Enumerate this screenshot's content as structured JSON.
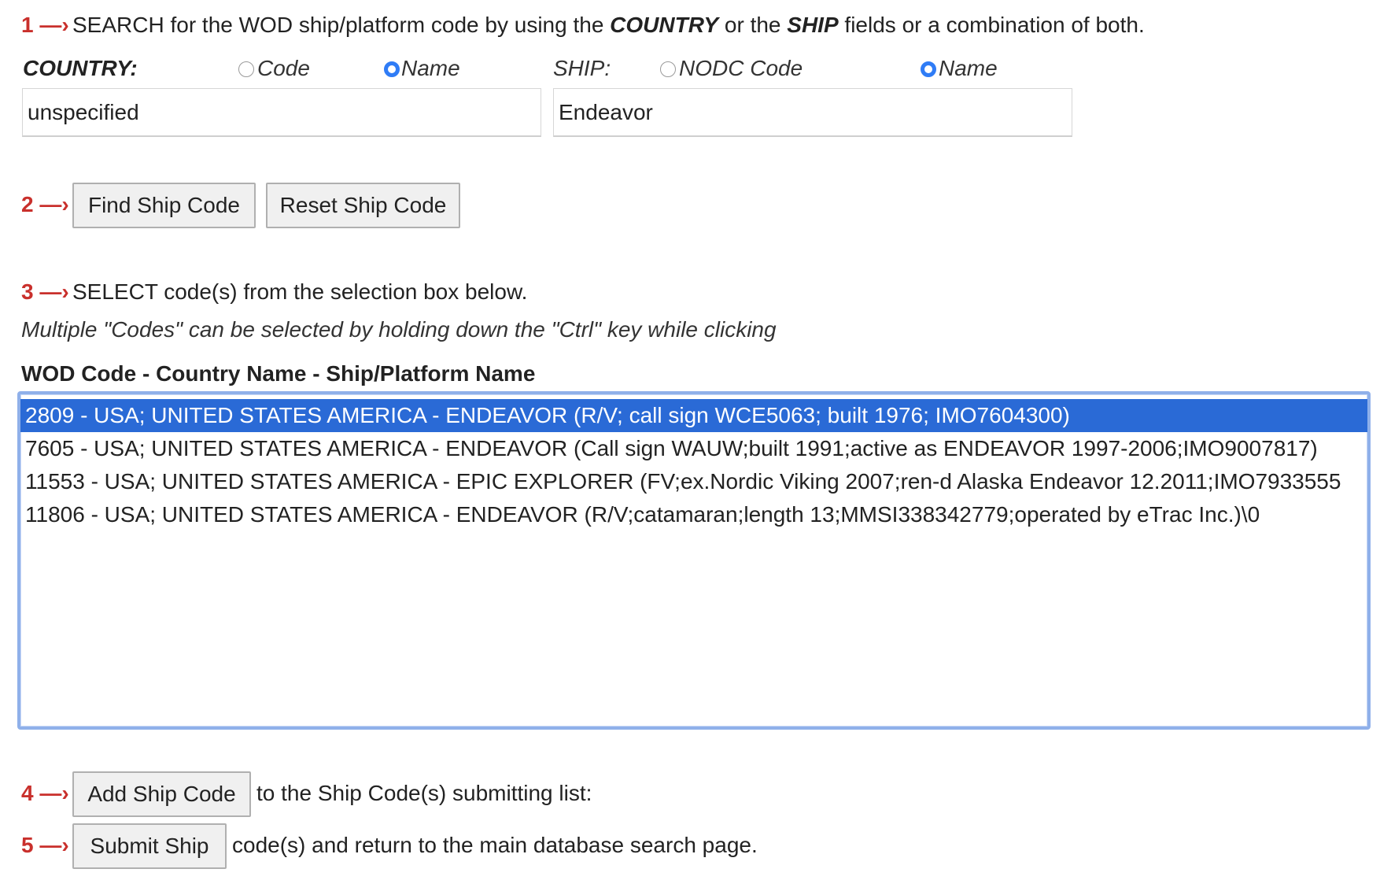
{
  "steps": {
    "s1": "1 —›",
    "s2": "2 —›",
    "s3": "3 —›",
    "s4": "4 —›",
    "s5": "5 —›"
  },
  "instruction1": {
    "a": "SEARCH for the WOD ship/platform code by using the ",
    "country_word": "COUNTRY",
    "b": " or the ",
    "ship_word": "SHIP",
    "c": " fields or a combination of both."
  },
  "country": {
    "label": "COUNTRY:",
    "radio_code": "Code",
    "radio_name": "Name",
    "selected": "Name",
    "value": "unspecified"
  },
  "ship": {
    "label": "SHIP:",
    "radio_code": "NODC Code",
    "radio_name": "Name",
    "selected": "Name",
    "value": "Endeavor"
  },
  "buttons": {
    "find": "Find Ship Code",
    "reset": "Reset Ship Code",
    "add": "Add Ship Code",
    "submit": "Submit Ship"
  },
  "instruction3": "SELECT code(s) from the selection box below.",
  "note": "Multiple \"Codes\" can be selected by holding down the \"Ctrl\" key while clicking",
  "list_header": "WOD Code - Country Name - Ship/Platform Name",
  "options": [
    {
      "text": "2809 - USA; UNITED STATES AMERICA - ENDEAVOR (R/V; call sign WCE5063; built 1976; IMO7604300)",
      "selected": true
    },
    {
      "text": "7605 - USA; UNITED STATES AMERICA - ENDEAVOR (Call sign WAUW;built 1991;active as ENDEAVOR 1997-2006;IMO9007817)",
      "selected": false
    },
    {
      "text": "11553 - USA; UNITED STATES AMERICA - EPIC EXPLORER (FV;ex.Nordic Viking 2007;ren-d Alaska Endeavor 12.2011;IMO7933555",
      "selected": false
    },
    {
      "text": "11806 - USA; UNITED STATES AMERICA - ENDEAVOR (R/V;catamaran;length 13;MMSI338342779;operated by eTrac Inc.)\\0",
      "selected": false
    }
  ],
  "instruction4": "to the Ship Code(s) submitting list:",
  "instruction5": "code(s) and return to the main database search page.",
  "colors": {
    "step": "#c9302c",
    "radio_selected": "#2f7cf6",
    "option_selected_bg": "#2a6ad6",
    "listbox_border": "#8fb0ea"
  }
}
